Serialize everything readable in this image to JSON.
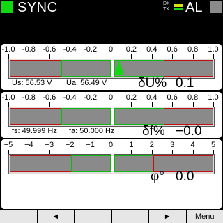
{
  "header": {
    "title": "SYNC",
    "dx": "DX",
    "tx": "TX",
    "status": "AL"
  },
  "panel1": {
    "scale": [
      "-1.0",
      "-0.8",
      "-0.6",
      "-0.4",
      "-0.2",
      "0",
      "0.2",
      "0.4",
      "0.6",
      "0.8",
      "1.0"
    ],
    "us": "Us: 56.53 V",
    "ua": "Ua: 56.49 V",
    "label": "δU%",
    "value": "0.1"
  },
  "panel2": {
    "scale": [
      "-1.0",
      "-0.8",
      "-0.6",
      "-0.4",
      "-0.2",
      "0",
      "0.2",
      "0.4",
      "0.6",
      "0.8",
      "1.0"
    ],
    "fs": "fs: 49.999 Hz",
    "fa": "fa: 50.000 Hz",
    "label": "δf%",
    "value": "−0.0"
  },
  "panel3": {
    "scale": [
      "−5",
      "−4",
      "−3",
      "−2",
      "−1",
      "0",
      "1",
      "2",
      "3",
      "4",
      "5"
    ],
    "label": "φ°",
    "value": "0.0"
  },
  "footer": {
    "buttons": [
      "",
      "◄",
      "",
      "",
      "►",
      "Menu"
    ]
  },
  "colors": {
    "green": "#12d812",
    "red": "#c01010",
    "gray": "#8a8a8a"
  }
}
